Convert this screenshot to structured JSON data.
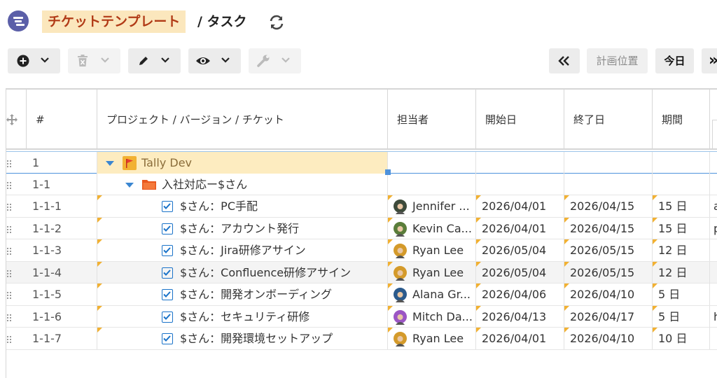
{
  "header": {
    "title_highlight": "チケットテンプレート",
    "title_rest": "/ タスク"
  },
  "toolbar": {
    "plan_position_label": "計画位置",
    "today_label": "今日",
    "expand_label": "»"
  },
  "grid": {
    "columns": {
      "num": "#",
      "name": "プロジェクト / バージョン / チケット",
      "assignee": "担当者",
      "start": "開始日",
      "end": "終了日",
      "duration": "期間"
    },
    "rows": [
      {
        "num": "1",
        "name": "Tally Dev",
        "assignee": "",
        "start": "",
        "end": "",
        "duration": "",
        "extra": ""
      },
      {
        "num": "1-1",
        "name": "入社対応ー$さん",
        "assignee": "",
        "start": "",
        "end": "",
        "duration": "",
        "extra": ""
      },
      {
        "num": "1-1-1",
        "name": "$さん：PC手配",
        "assignee": "Jennifer ...",
        "start": "2026/04/01",
        "end": "2026/04/15",
        "duration": "15 日",
        "extra": "a"
      },
      {
        "num": "1-1-2",
        "name": "$さん：アカウント発行",
        "assignee": "Kevin Ca...",
        "start": "2026/04/01",
        "end": "2026/04/15",
        "duration": "15 日",
        "extra": "p"
      },
      {
        "num": "1-1-3",
        "name": "$さん：Jira研修アサイン",
        "assignee": "Ryan Lee",
        "start": "2026/05/04",
        "end": "2026/05/15",
        "duration": "12 日",
        "extra": ""
      },
      {
        "num": "1-1-4",
        "name": "$さん：Confluence研修アサイン",
        "assignee": "Ryan Lee",
        "start": "2026/05/04",
        "end": "2026/05/15",
        "duration": "12 日",
        "extra": ""
      },
      {
        "num": "1-1-5",
        "name": "$さん：開発オンボーディング",
        "assignee": "Alana Gr...",
        "start": "2026/04/06",
        "end": "2026/04/10",
        "duration": "5 日",
        "extra": ""
      },
      {
        "num": "1-1-6",
        "name": "$さん：セキュリティ研修",
        "assignee": "Mitch Da...",
        "start": "2026/04/13",
        "end": "2026/04/17",
        "duration": "5 日",
        "extra": "h"
      },
      {
        "num": "1-1-7",
        "name": "$さん：開発環境セットアップ",
        "assignee": "Ryan Lee",
        "start": "2026/04/01",
        "end": "2026/04/10",
        "duration": "10 日",
        "extra": ""
      }
    ]
  },
  "icons": {
    "logo": "gantt-logo-icon",
    "refresh": "refresh-icon",
    "add": "plus-circle-icon",
    "delete": "trash-icon",
    "edit": "pencil-icon",
    "view": "eye-icon",
    "tools": "wrench-icon",
    "collapse": "double-chevron-left-icon",
    "move": "move-icon",
    "project": "flag-icon",
    "version": "folder-icon",
    "issue": "checkbox-icon"
  },
  "colors": {
    "accent": "#b13a16",
    "highlight": "#fbe7bd",
    "selected_row": "#fdecc0",
    "link_blue": "#1a73c9"
  }
}
